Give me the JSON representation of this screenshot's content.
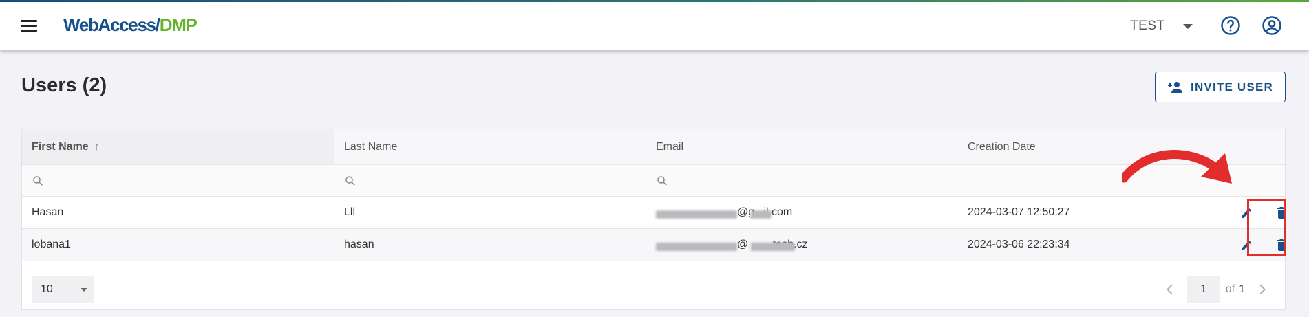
{
  "header": {
    "logo_part1": "WebAccess/",
    "logo_part2": "DMP",
    "org_selector": "TEST",
    "help_icon": "help-circle-icon",
    "account_icon": "account-circle-icon",
    "menu_icon": "hamburger-menu-icon"
  },
  "page": {
    "title": "Users (2)",
    "invite_button": "INVITE USER"
  },
  "table": {
    "columns": [
      "First Name",
      "Last Name",
      "Email",
      "Creation Date"
    ],
    "sort_indicator": "↑",
    "rows": [
      {
        "first_name": "Hasan",
        "last_name": "Lll",
        "email_visible": "@g   il.com",
        "email_suffix": "il.com",
        "creation_date": "2024-03-07 12:50:27"
      },
      {
        "first_name": "lobana1",
        "last_name": "hasan",
        "email_visible": "@        tech.cz",
        "email_suffix": "tech.cz",
        "creation_date": "2024-03-06 22:23:34"
      }
    ]
  },
  "pagination": {
    "rows_per_page": "10",
    "current_page": "1",
    "of_label": "of",
    "total_pages": "1"
  },
  "colors": {
    "brand_blue": "#17508b",
    "brand_green": "#65b32e",
    "annotation_red": "#e32d2d"
  }
}
